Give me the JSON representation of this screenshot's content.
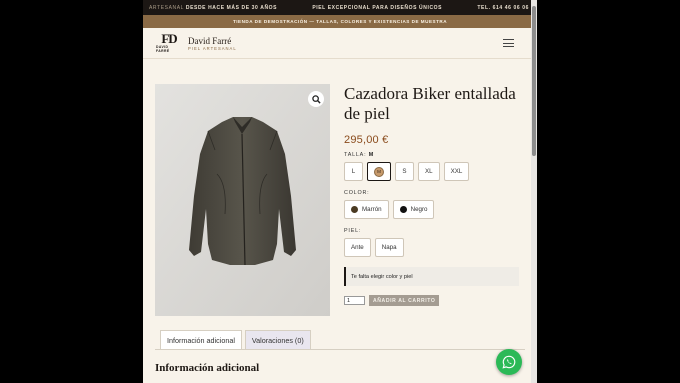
{
  "topbar": {
    "left_muted": "ARTESANAL",
    "left_bold": "DESDE HACE MÁS DE 30 AÑOS",
    "center": "PIEL EXCEPCIONAL PARA DISEÑOS ÚNICOS",
    "right": "TEL. 614 46 06 06"
  },
  "promo": {
    "text": "TIENDA DE DEMOSTRACIÓN — TALLAS, COLORES Y EXISTENCIAS DE MUESTRA"
  },
  "header": {
    "logo_mark": "FD",
    "logo_mark_sub": "DAVID FARRÉ",
    "brand_name": "David Farré",
    "brand_tagline": "PIEL ARTESANAL",
    "menu_icon": "hamburger-icon"
  },
  "product": {
    "title": "Cazadora Biker entallada de piel",
    "price": "295,00 €",
    "image_alt": "leather-jacket-image",
    "zoom_icon": "magnifier-icon",
    "size_label": "TALLA:",
    "size_selected": "M",
    "sizes": [
      "L",
      "M",
      "S",
      "XL",
      "XXL"
    ],
    "color_label": "COLOR:",
    "colors": [
      {
        "label": "Marrón",
        "hex": "#4a3a22"
      },
      {
        "label": "Negro",
        "hex": "#111111"
      }
    ],
    "leather_label": "PIEL:",
    "leathers": [
      "Ante",
      "Napa"
    ],
    "notice": "Te falta elegir color y piel",
    "qty": "1",
    "add_to_cart": "AÑADIR AL CARRITO"
  },
  "tabs": [
    {
      "label": "Información adicional",
      "active": true
    },
    {
      "label": "Valoraciones (0)",
      "active": false
    }
  ],
  "section_heading": "Información adicional",
  "floating": {
    "whatsapp_icon": "whatsapp-icon",
    "color": "#2bb957"
  },
  "colors": {
    "accent": "#8a6a45",
    "price": "#8a4b1c",
    "topbar": "#1c1714"
  }
}
